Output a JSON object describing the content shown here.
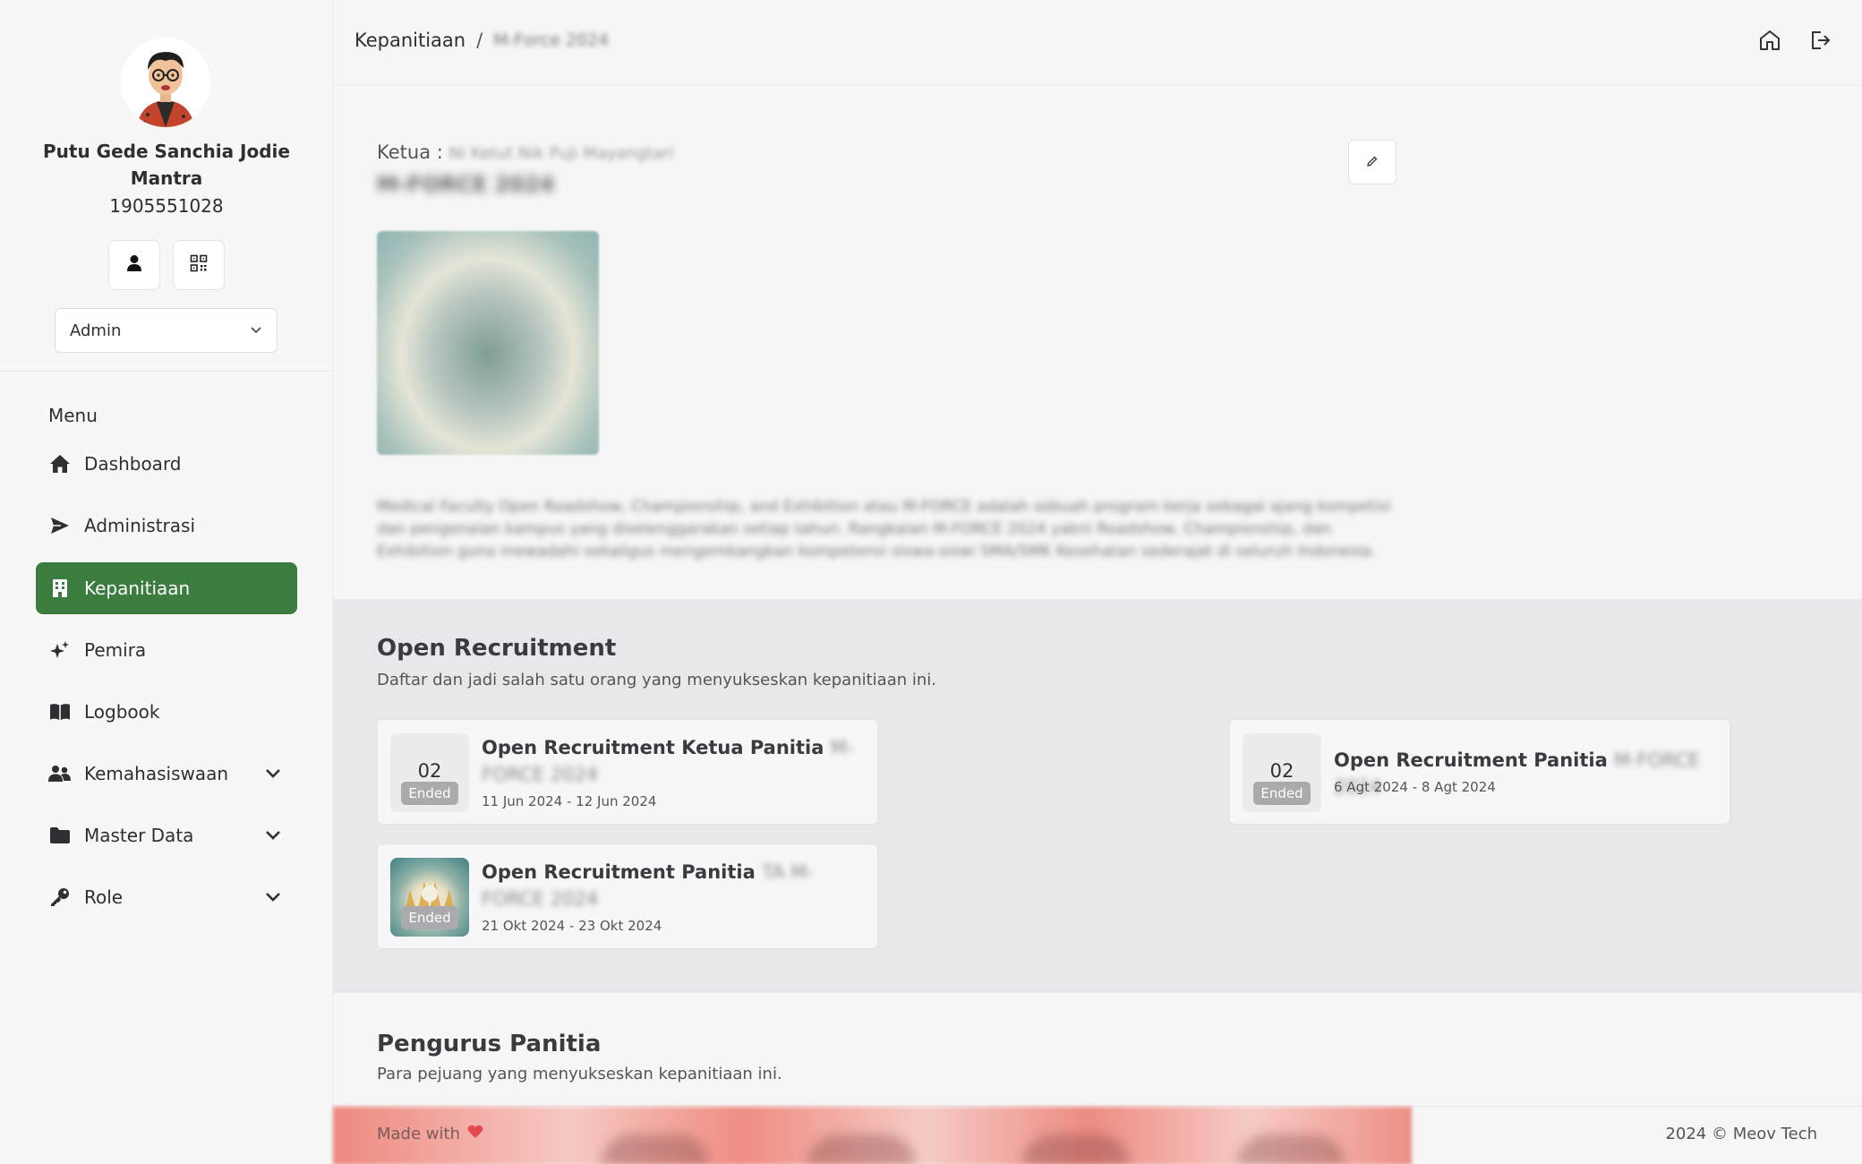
{
  "sidebar": {
    "user_name": "Putu Gede Sanchia Jodie Mantra",
    "user_nim": "1905551028",
    "role_selected": "Admin",
    "menu_title": "Menu",
    "items": [
      {
        "label": "Dashboard",
        "icon": "home-icon"
      },
      {
        "label": "Administrasi",
        "icon": "send-icon"
      },
      {
        "label": "Kepanitiaan",
        "icon": "building-icon",
        "active": true
      },
      {
        "label": "Pemira",
        "icon": "sparkles-icon"
      },
      {
        "label": "Logbook",
        "icon": "book-icon"
      },
      {
        "label": "Kemahasiswaan",
        "icon": "users-icon",
        "expandable": true
      },
      {
        "label": "Master Data",
        "icon": "folder-icon",
        "expandable": true
      },
      {
        "label": "Role",
        "icon": "key-icon",
        "expandable": true
      }
    ]
  },
  "header": {
    "breadcrumb_root": "Kepanitiaan",
    "breadcrumb_sep": "/",
    "breadcrumb_current": "M-Force 2024"
  },
  "committee": {
    "ketua_label": "Ketua :",
    "ketua_name": "Ni Ketut Nik Puji Mayangtari",
    "title": "M-FORCE 2024",
    "description": "Medical Faculty Open Roadshow, Championship, and Exhibition atau M-FORCE adalah sebuah program kerja sebagai ajang kompetisi dan pengenalan kampus yang diselenggarakan setiap tahun. Rangkaian M-FORCE 2024 yakni Roadshow, Championship, dan Exhibition guna mewadahi sekaligus mengembangkan kompetensi siswa-siswi SMA/SMK Kesehatan sederajat di seluruh Indonesia."
  },
  "open_recruitment": {
    "title": "Open Recruitment",
    "subtitle": "Daftar dan jadi salah satu orang yang menyukseskan kepanitiaan ini.",
    "cards": [
      {
        "day": "02",
        "badge": "Ended",
        "title": "Open Recruitment Ketua Panitia",
        "title_suffix": "M-FORCE 2024",
        "range": "11 Jun 2024 - 12 Jun 2024"
      },
      {
        "day": "02",
        "badge": "Ended",
        "title": "Open Recruitment Panitia",
        "title_suffix": "M-FORCE 2024",
        "range": "6 Agt 2024 - 8 Agt 2024"
      },
      {
        "badge": "Ended",
        "title": "Open Recruitment Panitia",
        "title_suffix": "TA M-FORCE 2024",
        "range": "21 Okt 2024 - 23 Okt 2024"
      }
    ]
  },
  "pengurus": {
    "title": "Pengurus Panitia",
    "subtitle": "Para pejuang yang menyukseskan kepanitiaan ini."
  },
  "footer": {
    "made_with": "Made with",
    "copyright": "2024 © Meov Tech"
  },
  "colors": {
    "accent": "#3b7d3e",
    "badge": "#a9a9ae",
    "heart": "#e5484d"
  }
}
